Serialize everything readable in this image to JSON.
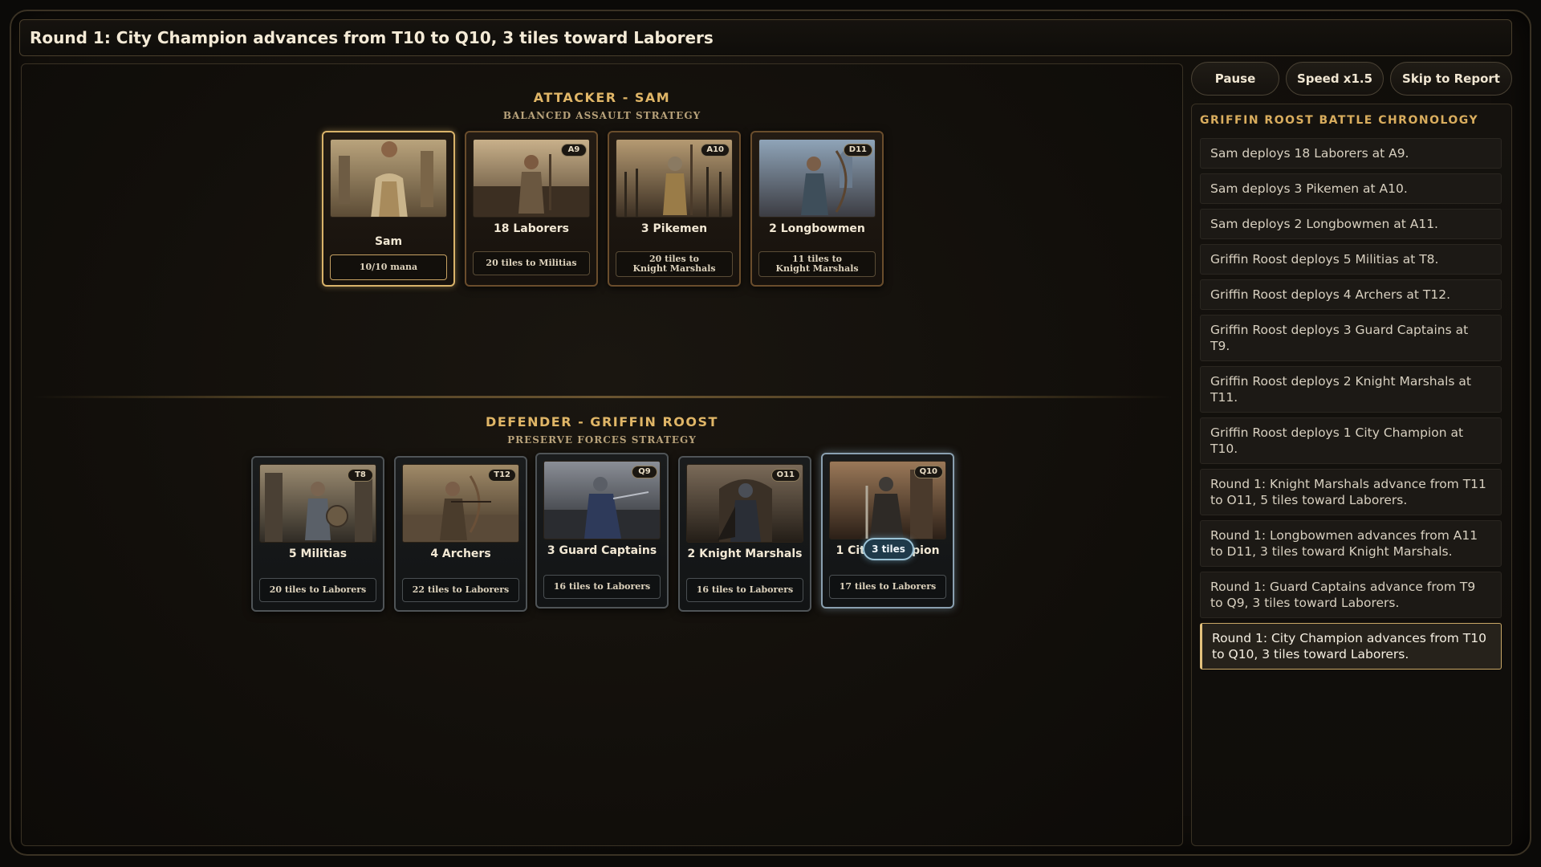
{
  "header": {
    "title": "Round 1: City Champion advances from T10 to Q10, 3 tiles toward Laborers"
  },
  "controls": {
    "pause": "Pause",
    "speed": "Speed x1.5",
    "skip": "Skip to Report"
  },
  "attacker": {
    "title": "ATTACKER - SAM",
    "strategy": "BALANCED ASSAULT STRATEGY",
    "cards": [
      {
        "name": "Sam",
        "info": "10/10 mana",
        "badge": "",
        "icon": "hero-commander-portrait"
      },
      {
        "name": "18 Laborers",
        "info": "20 tiles to Militias",
        "badge": "A9",
        "icon": "laborer-unit-portrait"
      },
      {
        "name": "3 Pikemen",
        "info": "20 tiles to\nKnight Marshals",
        "badge": "A10",
        "icon": "pikeman-unit-portrait"
      },
      {
        "name": "2 Longbowmen",
        "info": "11 tiles to\nKnight Marshals",
        "badge": "D11",
        "icon": "longbowman-unit-portrait"
      }
    ]
  },
  "defender": {
    "title": "DEFENDER - GRIFFIN ROOST",
    "strategy": "PRESERVE FORCES STRATEGY",
    "cards": [
      {
        "name": "5 Militias",
        "info": "20 tiles to Laborers",
        "badge": "T8",
        "icon": "militia-unit-portrait"
      },
      {
        "name": "4 Archers",
        "info": "22 tiles to Laborers",
        "badge": "T12",
        "icon": "archer-unit-portrait"
      },
      {
        "name": "3 Guard Captains",
        "info": "16 tiles to Laborers",
        "badge": "Q9",
        "icon": "guard-captain-unit-portrait"
      },
      {
        "name": "2 Knight Marshals",
        "info": "16 tiles to Laborers",
        "badge": "O11",
        "icon": "knight-marshal-unit-portrait"
      },
      {
        "name": "1 City Champion",
        "info": "17 tiles to Laborers",
        "badge": "Q10",
        "icon": "city-champion-unit-portrait",
        "move_pill": "3 tiles"
      }
    ]
  },
  "chronology": {
    "title": "GRIFFIN ROOST BATTLE CHRONOLOGY",
    "entries": [
      "Sam deploys 18 Laborers at A9.",
      "Sam deploys 3 Pikemen at A10.",
      "Sam deploys 2 Longbowmen at A11.",
      "Griffin Roost deploys 5 Militias at T8.",
      "Griffin Roost deploys 4 Archers at T12.",
      "Griffin Roost deploys 3 Guard Captains at T9.",
      "Griffin Roost deploys 2 Knight Marshals at T11.",
      "Griffin Roost deploys 1 City Champion at T10.",
      "Round 1: Knight Marshals advance from T11 to O11, 5 tiles toward Laborers.",
      "Round 1: Longbowmen advances from A11 to D11, 3 tiles toward Knight Marshals.",
      "Round 1: Guard Captains advance from T9 to Q9, 3 tiles toward Laborers.",
      "Round 1: City Champion advances from T10 to Q10, 3 tiles toward Laborers."
    ]
  },
  "colors": {
    "accent_gold": "#e0b667",
    "active_blue": "#9cc3d6",
    "panel_bg": "#120f0b"
  }
}
